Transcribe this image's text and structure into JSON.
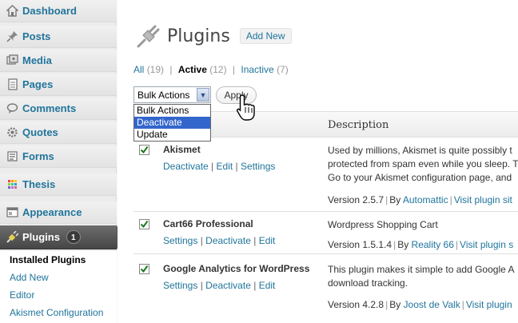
{
  "sidebar": {
    "items": [
      {
        "label": "Dashboard",
        "icon": "dashboard-icon"
      },
      {
        "label": "Posts",
        "icon": "pin-icon"
      },
      {
        "label": "Media",
        "icon": "media-icon"
      },
      {
        "label": "Pages",
        "icon": "pages-icon"
      },
      {
        "label": "Comments",
        "icon": "comments-icon"
      },
      {
        "label": "Quotes",
        "icon": "gear-icon"
      },
      {
        "label": "Forms",
        "icon": "forms-icon"
      },
      {
        "label": "Thesis",
        "icon": "thesis-icon"
      },
      {
        "label": "Appearance",
        "icon": "appearance-icon"
      },
      {
        "label": "Plugins",
        "icon": "plugin-icon",
        "badge": "1"
      }
    ],
    "submenu": [
      {
        "label": "Installed Plugins"
      },
      {
        "label": "Add New"
      },
      {
        "label": "Editor"
      },
      {
        "label": "Akismet Configuration"
      }
    ]
  },
  "header": {
    "title": "Plugins",
    "add_new": "Add New"
  },
  "filters": {
    "all": "All",
    "all_count": "(19)",
    "active": "Active",
    "active_count": "(12)",
    "inactive": "Inactive",
    "inactive_count": "(7)",
    "sep": "|"
  },
  "bulk": {
    "selected": "Bulk Actions",
    "options": [
      "Bulk Actions",
      "Deactivate",
      "Update"
    ],
    "apply": "Apply"
  },
  "table": {
    "description_header": "Description",
    "rows": [
      {
        "name": "Akismet",
        "actions": [
          "Deactivate",
          "Edit",
          "Settings"
        ],
        "desc_lines": [
          "Used by millions, Akismet is quite possibly t",
          "protected from spam even while you sleep. T",
          "Go to your Akismet configuration page, and"
        ],
        "version": "Version 2.5.7",
        "by": "By",
        "author": "Automattic",
        "visit": "Visit plugin sit"
      },
      {
        "name": "Cart66 Professional",
        "actions": [
          "Settings",
          "Deactivate",
          "Edit"
        ],
        "desc_lines": [
          "Wordpress Shopping Cart"
        ],
        "version": "Version 1.5.1.4",
        "by": "By",
        "author": "Reality 66",
        "visit": "Visit plugin s"
      },
      {
        "name": "Google Analytics for WordPress",
        "actions": [
          "Settings",
          "Deactivate",
          "Edit"
        ],
        "desc_lines": [
          "This plugin makes it simple to add Google A",
          "download tracking."
        ],
        "version": "Version 4.2.8",
        "by": "By",
        "author": "Joost de Valk",
        "visit": "Visit plugin"
      }
    ]
  },
  "colors": {
    "link": "#21759b",
    "active_menu": "#464646",
    "dropdown_highlight": "#3366cc"
  }
}
